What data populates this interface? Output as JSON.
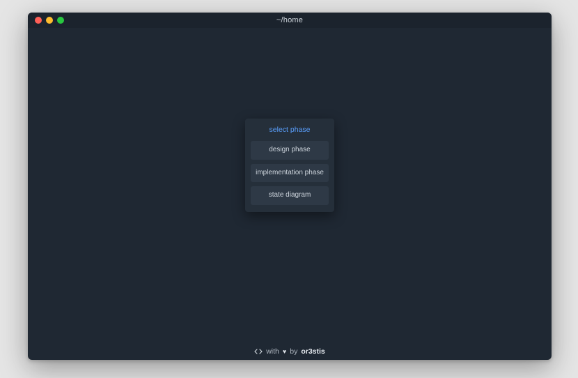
{
  "window": {
    "title": "~/home"
  },
  "menu": {
    "header": "select phase",
    "items": [
      {
        "label": "design phase"
      },
      {
        "label": "implementation phase"
      },
      {
        "label": "state diagram"
      }
    ]
  },
  "footer": {
    "with": "with",
    "by": "by",
    "author": "or3stis"
  }
}
